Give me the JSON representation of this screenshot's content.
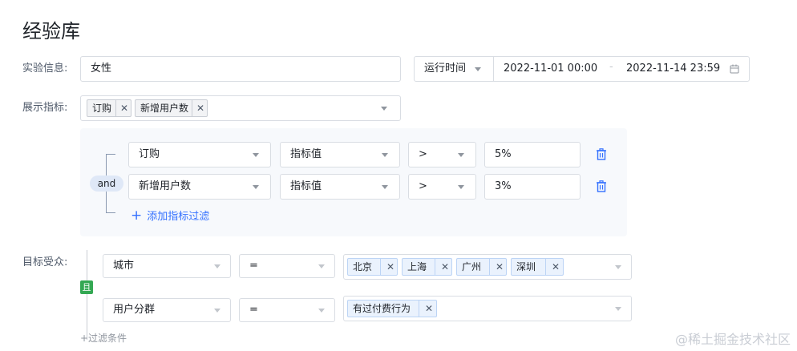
{
  "page_title": "经验库",
  "experiment": {
    "label": "实验信息:",
    "value": "女性",
    "time_select": "运行时间",
    "start": "2022-11-01 00:00",
    "dash": "-",
    "end": "2022-11-14 23:59"
  },
  "metrics": {
    "label": "展示指标:",
    "tags": [
      "订购",
      "新增用户数"
    ]
  },
  "filters": {
    "logic": "and",
    "rows": [
      {
        "metric": "订购",
        "type": "指标值",
        "op": ">",
        "value": "5%"
      },
      {
        "metric": "新增用户数",
        "type": "指标值",
        "op": ">",
        "value": "3%"
      }
    ],
    "add_label": "添加指标过滤"
  },
  "audience": {
    "label": "目标受众:",
    "logic": "且",
    "rows": [
      {
        "field": "城市",
        "op": "=",
        "tags": [
          "北京",
          "上海",
          "广州",
          "深圳"
        ]
      },
      {
        "field": "用户分群",
        "op": "=",
        "tags": [
          "有过付费行为"
        ]
      }
    ],
    "add_label": "+过滤条件"
  },
  "watermark": "@稀土掘金技术社区",
  "colors": {
    "accent": "#3370ff",
    "logic_green": "#34a853",
    "panel_bg": "#f7f9fc"
  }
}
